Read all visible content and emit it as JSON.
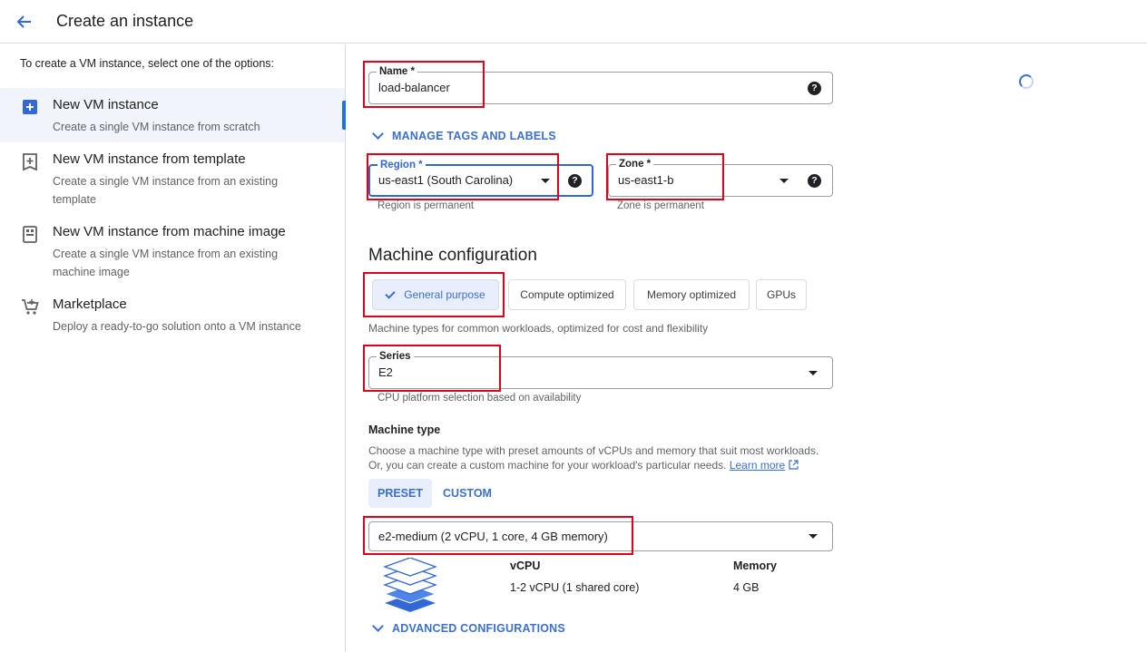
{
  "header": {
    "title": "Create an instance"
  },
  "sidebar": {
    "intro": "To create a VM instance, select one of the options:",
    "options": [
      {
        "title": "New VM instance",
        "desc": "Create a single VM instance from scratch",
        "icon": "add-box-icon",
        "selected": true
      },
      {
        "title": "New VM instance from template",
        "desc": "Create a single VM instance from an existing template",
        "icon": "template-icon",
        "selected": false
      },
      {
        "title": "New VM instance from machine image",
        "desc": "Create a single VM instance from an existing machine image",
        "icon": "machine-image-icon",
        "selected": false
      },
      {
        "title": "Marketplace",
        "desc": "Deploy a ready-to-go solution onto a VM instance",
        "icon": "cart-icon",
        "selected": false
      }
    ]
  },
  "form": {
    "name": {
      "label": "Name *",
      "value": "load-balancer"
    },
    "manage_tags": "MANAGE TAGS AND LABELS",
    "region": {
      "label": "Region *",
      "value": "us-east1 (South Carolina)",
      "hint": "Region is permanent"
    },
    "zone": {
      "label": "Zone *",
      "value": "us-east1-b",
      "hint": "Zone is permanent"
    },
    "machine_config": {
      "heading": "Machine configuration",
      "families": [
        "General purpose",
        "Compute optimized",
        "Memory optimized",
        "GPUs"
      ],
      "selected_family": "General purpose",
      "family_desc": "Machine types for common workloads, optimized for cost and flexibility",
      "series": {
        "label": "Series",
        "value": "E2",
        "hint": "CPU platform selection based on availability"
      },
      "machine_type": {
        "heading": "Machine type",
        "desc_line1": "Choose a machine type with preset amounts of vCPUs and memory that suit most workloads.",
        "desc_line2": "Or, you can create a custom machine for your workload's particular needs.",
        "learn_more": "Learn more",
        "tabs": [
          "PRESET",
          "CUSTOM"
        ],
        "selected_tab": "PRESET",
        "value": "e2-medium (2 vCPU, 1 core, 4 GB memory)",
        "vcpu_header": "vCPU",
        "vcpu_value": "1-2 vCPU (1 shared core)",
        "memory_header": "Memory",
        "memory_value": "4 GB"
      }
    },
    "advanced": "ADVANCED CONFIGURATIONS"
  },
  "colors": {
    "accent": "#3c6fcf",
    "highlight": "#e0001a",
    "selected_bg": "#e8eefb"
  }
}
